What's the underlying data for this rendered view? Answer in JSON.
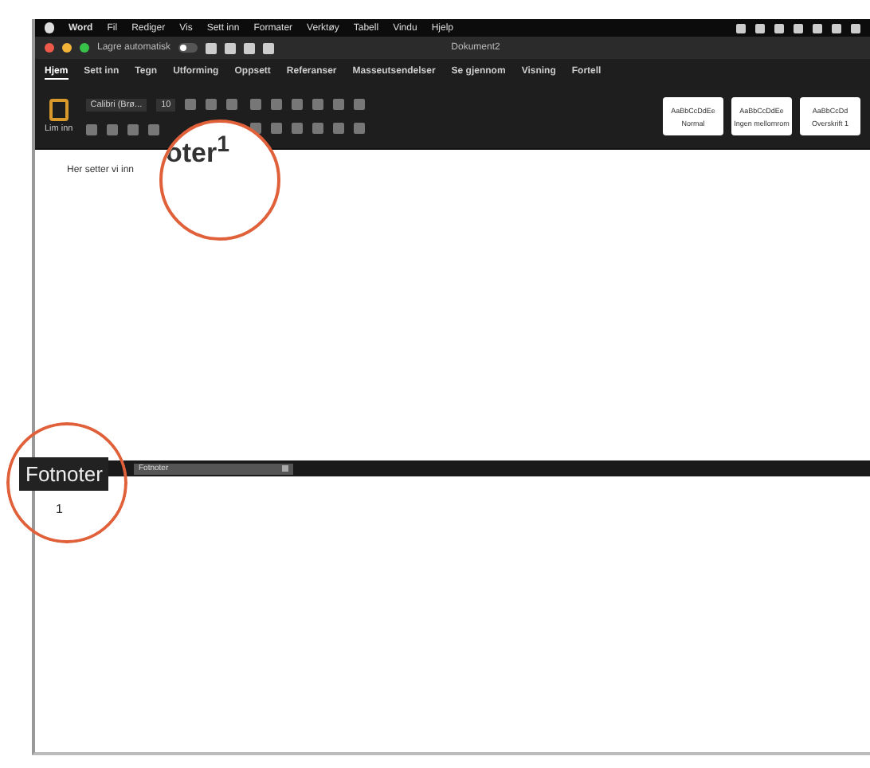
{
  "menu_bar": {
    "app": "Word",
    "items": [
      "Fil",
      "Rediger",
      "Vis",
      "Sett inn",
      "Formater",
      "Verktøy",
      "Tabell",
      "Vindu",
      "Hjelp"
    ]
  },
  "title_bar": {
    "autosave_label": "Lagre automatisk",
    "autosave_on": false,
    "title": "Dokument2"
  },
  "ribbon_tabs": [
    {
      "label": "Hjem",
      "selected": true
    },
    {
      "label": "Sett inn",
      "selected": false
    },
    {
      "label": "Tegn",
      "selected": false
    },
    {
      "label": "Utforming",
      "selected": false
    },
    {
      "label": "Oppsett",
      "selected": false
    },
    {
      "label": "Referanser",
      "selected": false
    },
    {
      "label": "Masseutsendelser",
      "selected": false
    },
    {
      "label": "Se gjennom",
      "selected": false
    },
    {
      "label": "Visning",
      "selected": false
    },
    {
      "label": "Fortell",
      "selected": false
    }
  ],
  "ribbon": {
    "paste_label": "Lim inn",
    "font": "Calibri (Brø...",
    "size": "10",
    "styles": [
      {
        "sample": "AaBbCcDdEe",
        "name": "Normal"
      },
      {
        "sample": "AaBbCcDdEe",
        "name": "Ingen mellomrom"
      },
      {
        "sample": "AaBbCcDd",
        "name": "Overskrift 1"
      }
    ]
  },
  "document": {
    "text": "Her setter vi inn",
    "magnified": "oter$^{1}$"
  },
  "footnote_pane": {
    "magnified": "Fotnoter",
    "dropdown": "Fotnoter",
    "footnotes": [
      "1"
    ]
  }
}
